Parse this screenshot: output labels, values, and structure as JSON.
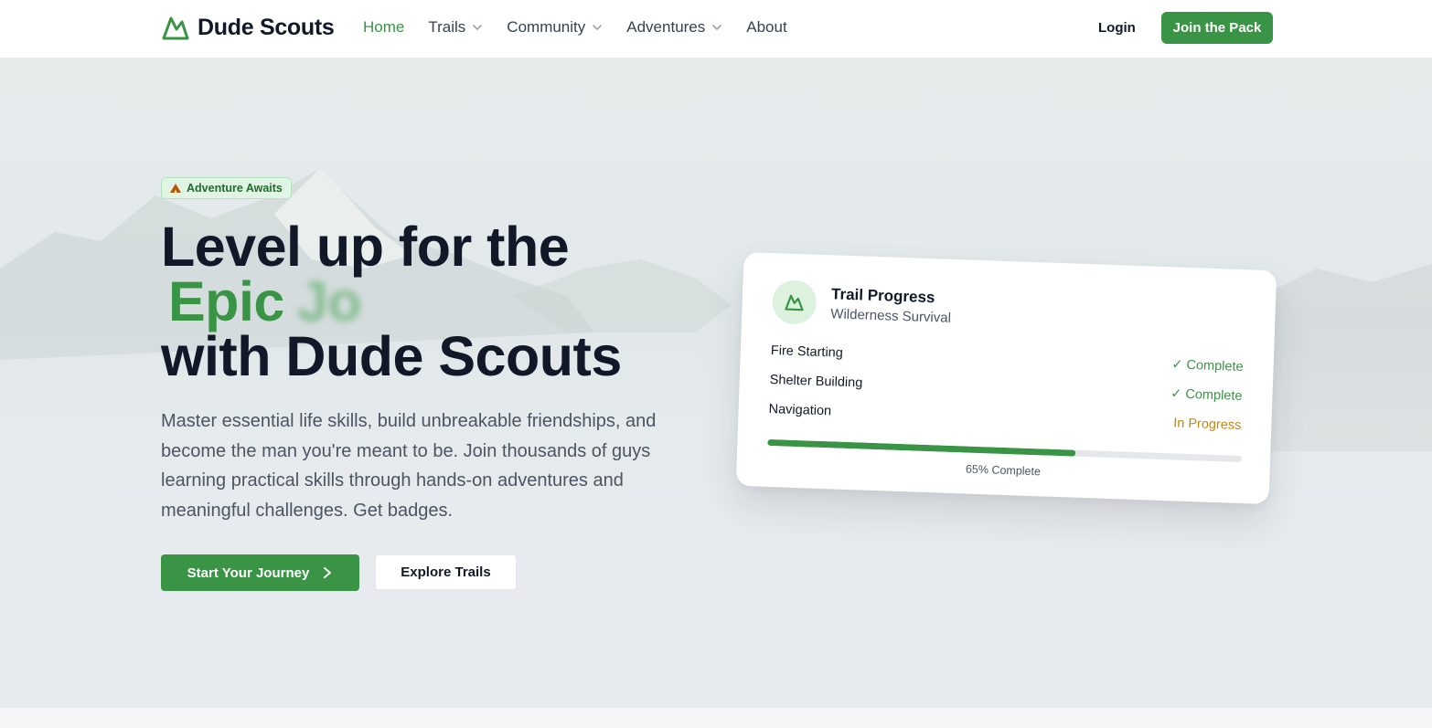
{
  "nav": {
    "brand": "Dude Scouts",
    "links": [
      {
        "label": "Home",
        "active": true,
        "dropdown": false
      },
      {
        "label": "Trails",
        "active": false,
        "dropdown": true
      },
      {
        "label": "Community",
        "active": false,
        "dropdown": true
      },
      {
        "label": "Adventures",
        "active": false,
        "dropdown": true
      },
      {
        "label": "About",
        "active": false,
        "dropdown": false
      }
    ],
    "login_label": "Login",
    "join_label": "Join the Pack"
  },
  "hero": {
    "badge_icon": "tent-icon",
    "badge_label": "Adventure Awaits",
    "headline_line1": "Level up for the",
    "headline_epic": "Epic",
    "headline_blurred": "Jo",
    "headline_line3": "with Dude Scouts",
    "lede": "Master essential life skills, build unbreakable friendships, and become the man you're meant to be. Join thousands of guys learning practical skills through hands-on adventures and meaningful challenges. Get badges.",
    "cta_primary": "Start Your Journey",
    "cta_secondary": "Explore Trails"
  },
  "card": {
    "icon": "mountain-icon",
    "title": "Trail Progress",
    "subtitle": "Wilderness Survival",
    "skills": [
      {
        "name": "Fire Starting",
        "status": "✓ Complete",
        "state": "done"
      },
      {
        "name": "Shelter Building",
        "status": "✓ Complete",
        "state": "done"
      },
      {
        "name": "Navigation",
        "status": "In Progress",
        "state": "progress"
      }
    ],
    "progress_value": 0.65,
    "progress_label": "65% Complete"
  },
  "colors": {
    "accent": "#3a9446",
    "accent_light": "#dcf2de",
    "in_progress": "#c2880a",
    "heading": "#111827",
    "body_text": "#4b5563"
  }
}
